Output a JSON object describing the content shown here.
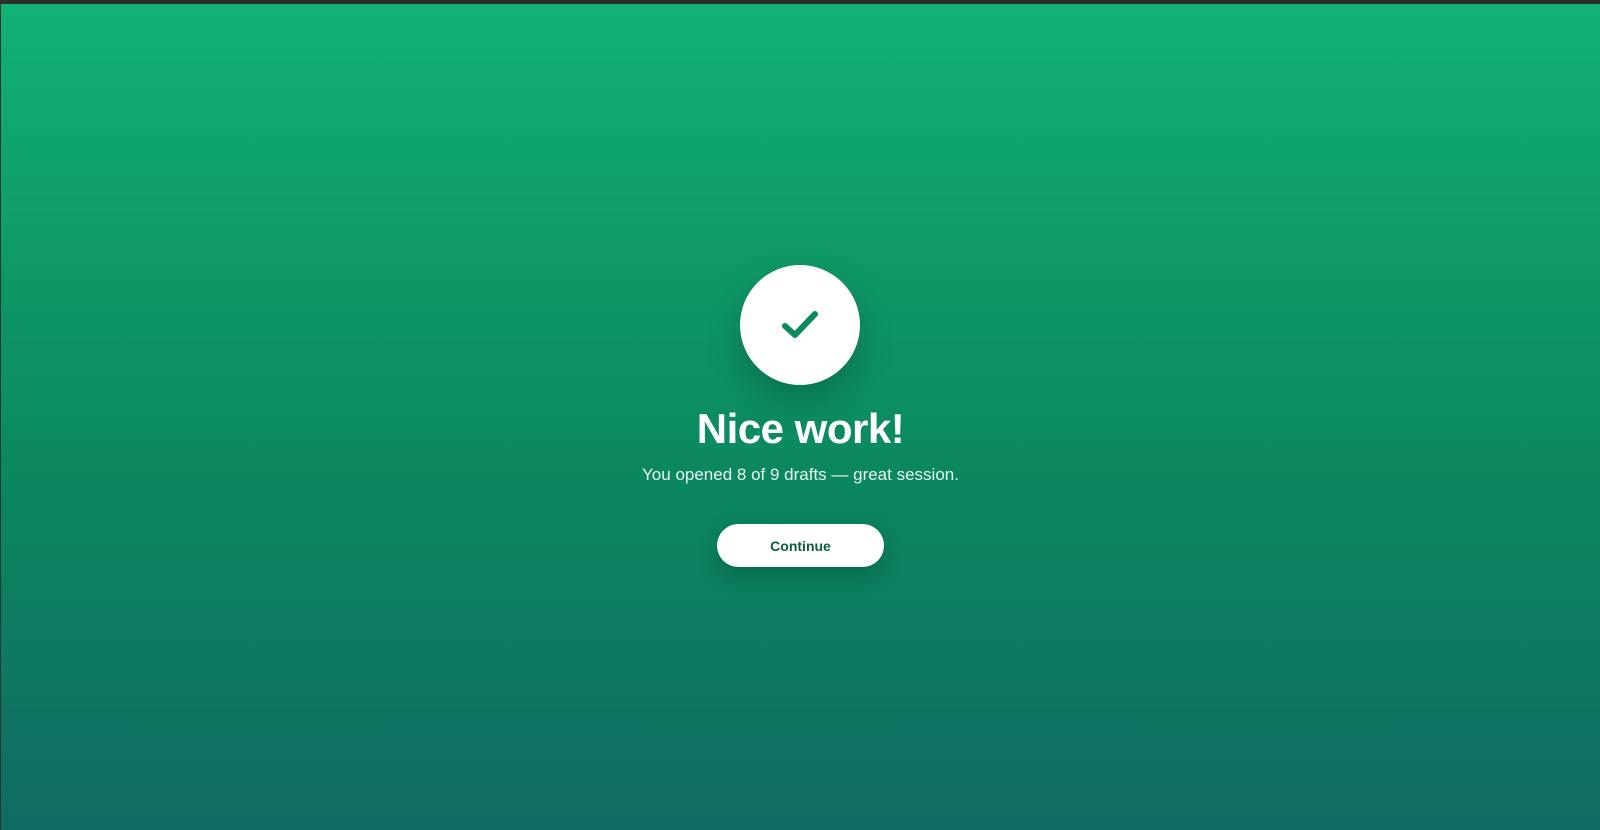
{
  "success_screen": {
    "icon": "check-icon",
    "title": "Nice work!",
    "subtitle": "You opened 8 of 9 drafts — great session.",
    "continue_label": "Continue"
  },
  "colors": {
    "gradient_top": "#12b277",
    "gradient_bottom": "#106b62",
    "check": "#0d8a5c",
    "button_text": "#0d5a45"
  }
}
